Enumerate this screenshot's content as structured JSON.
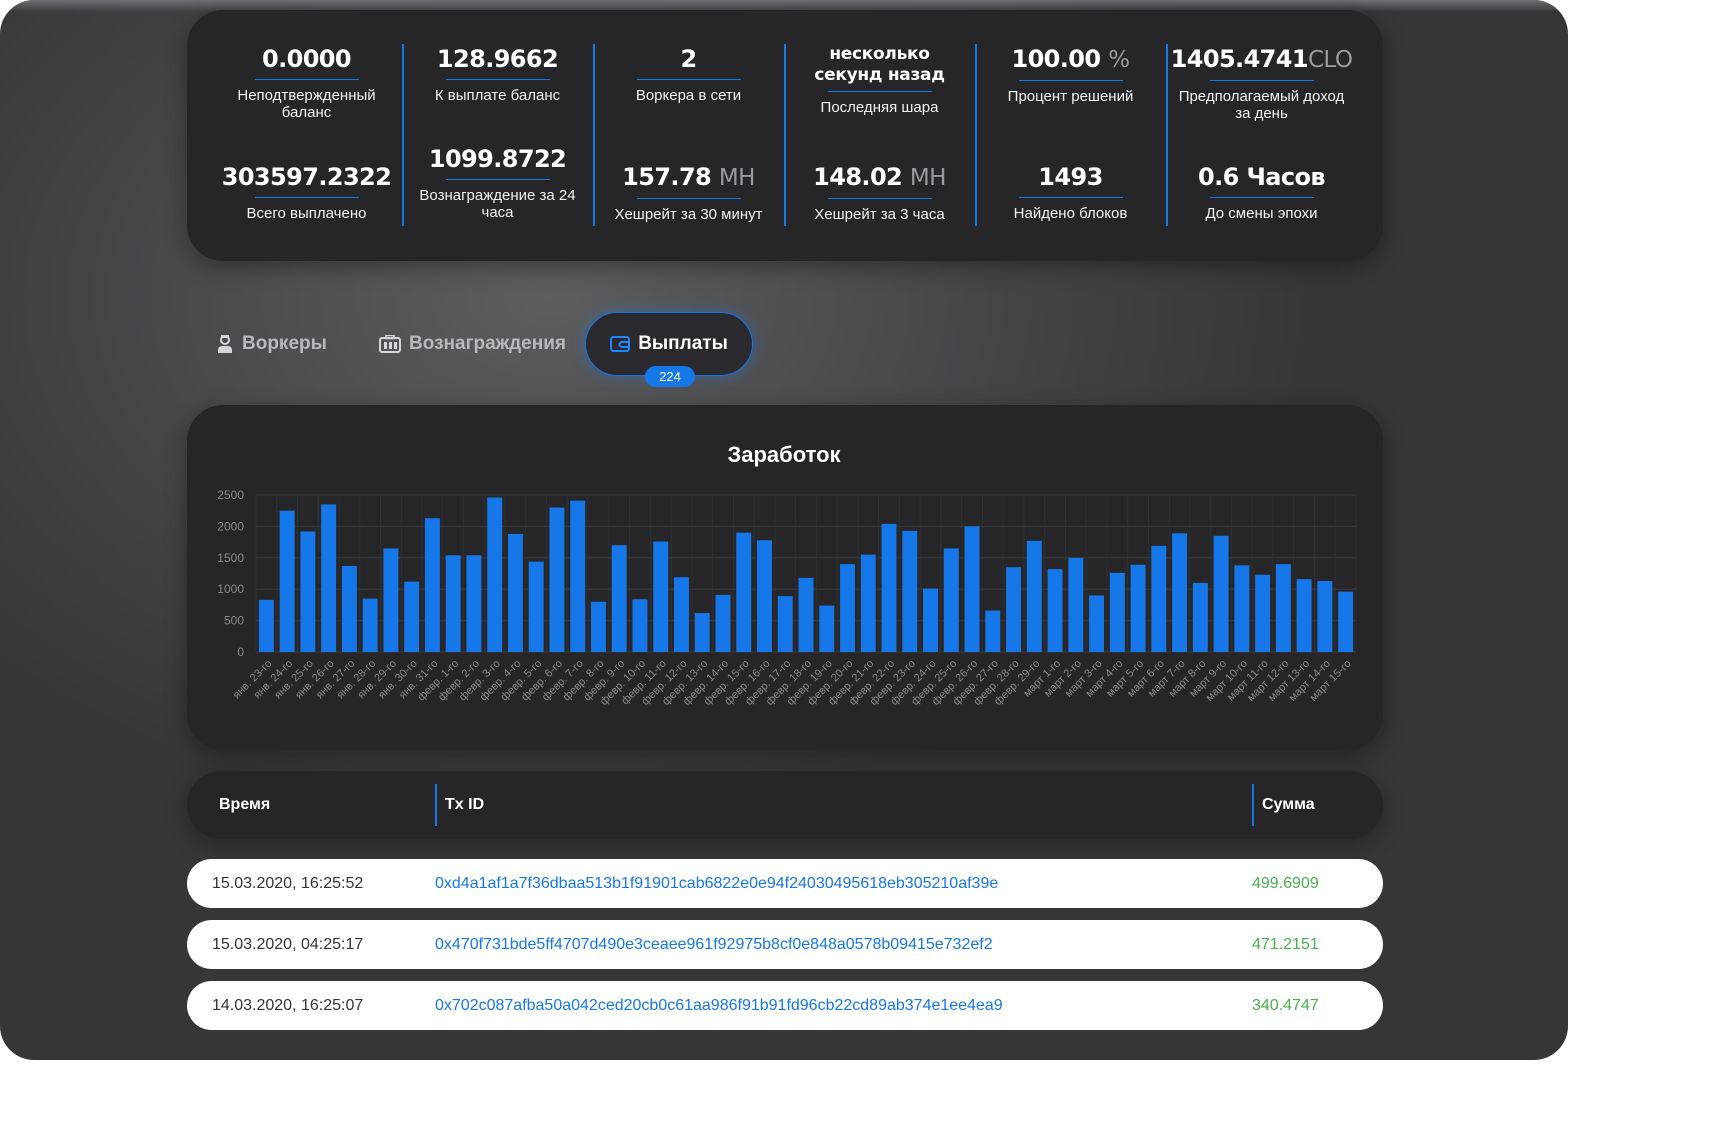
{
  "stats": [
    {
      "top": {
        "value": "0.0000",
        "unit": "",
        "label": "Неподтвержденный баланс"
      },
      "bottom": {
        "value": "303597.2322",
        "unit": "",
        "label": "Всего выплачено"
      }
    },
    {
      "top": {
        "value": "128.9662",
        "unit": "",
        "label": "К выплате баланс"
      },
      "bottom": {
        "value": "1099.8722",
        "unit": "",
        "label": "Вознаграждение за 24 часа"
      }
    },
    {
      "top": {
        "value": "2",
        "unit": "",
        "label": "Воркера в сети"
      },
      "bottom": {
        "value": "157.78",
        "unit": "MH",
        "label": "Хешрейт за 30 минут"
      }
    },
    {
      "top": {
        "value": "несколько секунд назад",
        "unit": "",
        "label": "Последняя шара"
      },
      "bottom": {
        "value": "148.02",
        "unit": "MH",
        "label": "Хешрейт за 3 часа"
      }
    },
    {
      "top": {
        "value": "100.00",
        "unit": "%",
        "label": "Процент решений"
      },
      "bottom": {
        "value": "1493",
        "unit": "",
        "label": "Найдено блоков"
      }
    },
    {
      "top": {
        "value": "1405.4741",
        "unit": "CLO",
        "label": "Предполагаемый доход за день"
      },
      "bottom": {
        "value": "0.6 Часов",
        "unit": "",
        "label": "До смены эпохи"
      }
    }
  ],
  "tabs": {
    "workers": {
      "label": "Воркеры",
      "icon": "worker-icon"
    },
    "rewards": {
      "label": "Вознаграждения",
      "icon": "reward-icon"
    },
    "payouts": {
      "label": "Выплаты",
      "icon": "wallet-icon",
      "badge": "224"
    }
  },
  "chart_title": "Заработок",
  "chart_data": {
    "type": "bar",
    "title": "Заработок",
    "xlabel": "",
    "ylabel": "",
    "ylim": [
      0,
      2500
    ],
    "yticks": [
      "0",
      "500",
      "1000",
      "1500",
      "2000",
      "2500"
    ],
    "grid": true,
    "color": "#1677e8",
    "categories": [
      "янв. 23-го",
      "янв. 24-го",
      "янв. 25-го",
      "янв. 26-го",
      "янв. 27-го",
      "янв. 28-го",
      "янв. 29-го",
      "янв. 30-го",
      "янв. 31-го",
      "февр. 1-го",
      "февр. 2-го",
      "февр. 3-го",
      "февр. 4-го",
      "февр. 5-го",
      "февр. 6-го",
      "февр. 7-го",
      "февр. 8-го",
      "февр. 9-го",
      "февр. 10-го",
      "февр. 11-го",
      "февр. 12-го",
      "февр. 13-го",
      "февр. 14-го",
      "февр. 15-го",
      "февр. 16-го",
      "февр. 17-го",
      "февр. 18-го",
      "февр. 19-го",
      "февр. 20-го",
      "февр. 21-го",
      "февр. 22-го",
      "февр. 23-го",
      "февр. 24-го",
      "февр. 25-го",
      "февр. 26-го",
      "февр. 27-го",
      "февр. 28-го",
      "февр. 29-го",
      "март 1-го",
      "март 2-го",
      "март 3-го",
      "март 4-го",
      "март 5-го",
      "март 6-го",
      "март 7-го",
      "март 8-го",
      "март 9-го",
      "март 10-го",
      "март 11-го",
      "март 12-го",
      "март 13-го",
      "март 14-го",
      "март 15-го"
    ],
    "values": [
      830,
      2250,
      1920,
      2350,
      1370,
      850,
      1650,
      1120,
      2130,
      1540,
      1540,
      2460,
      1880,
      1440,
      2300,
      2410,
      800,
      1700,
      840,
      1760,
      1190,
      620,
      910,
      1900,
      1780,
      890,
      1180,
      740,
      1400,
      1550,
      2040,
      1930,
      1010,
      1650,
      2000,
      660,
      1350,
      1770,
      1320,
      1500,
      900,
      1260,
      1390,
      1690,
      1890,
      1100,
      1850,
      1380,
      1230,
      1400,
      1160,
      1130,
      960
    ]
  },
  "table": {
    "headers": {
      "time": "Время",
      "txid": "Tx ID",
      "amount": "Сумма"
    },
    "rows": [
      {
        "time": "15.03.2020, 16:25:52",
        "txid": "0xd4a1af1a7f36dbaa513b1f91901cab6822e0e94f24030495618eb305210af39e",
        "amount": "499.6909"
      },
      {
        "time": "15.03.2020, 04:25:17",
        "txid": "0x470f731bde5ff4707d490e3ceaee961f92975b8cf0e848a0578b09415e732ef2",
        "amount": "471.2151"
      },
      {
        "time": "14.03.2020, 16:25:07",
        "txid": "0x702c087afba50a042ced20cb0c61aa986f91b91fd96cb22cd89ab374e1ee4ea9",
        "amount": "340.4747"
      }
    ]
  }
}
